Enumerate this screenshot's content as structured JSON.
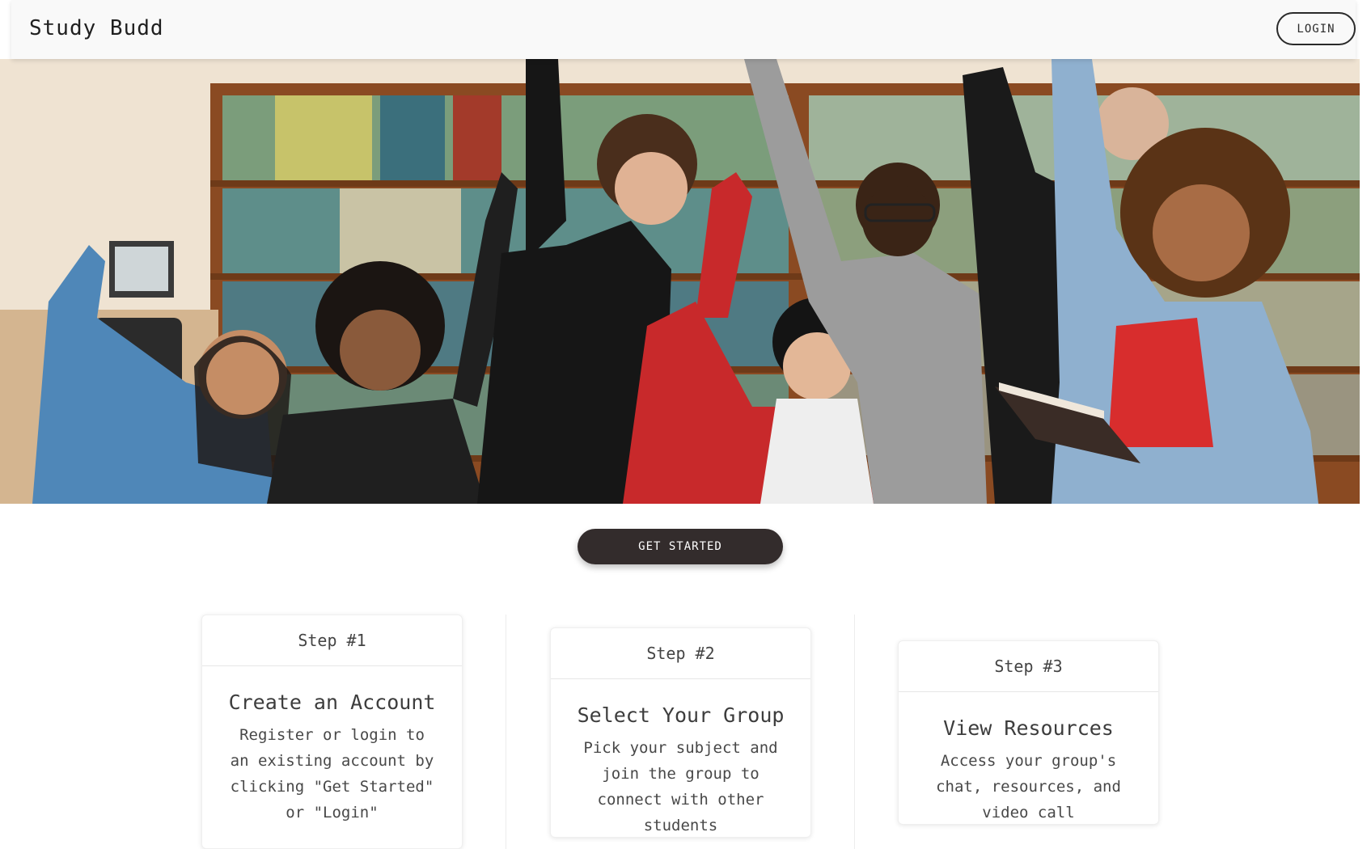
{
  "navbar": {
    "brand": "Study Budd",
    "login_label": "LOGIN"
  },
  "hero": {
    "description": "photo-of-students-celebrating-in-library"
  },
  "cta": {
    "label": "GET STARTED"
  },
  "steps": [
    {
      "header": "Step #1",
      "title": "Create an Account",
      "text": "Register or login to an existing account by clicking \"Get Started\" or \"Login\""
    },
    {
      "header": "Step #2",
      "title": "Select Your Group",
      "text": "Pick your subject and join the group to connect with other students"
    },
    {
      "header": "Step #3",
      "title": "View Resources",
      "text": "Access your group's chat, resources, and video call"
    }
  ],
  "colors": {
    "navbar_bg": "#f9f9f9",
    "cta_bg": "#332c2c",
    "text": "#3a3a3a"
  }
}
